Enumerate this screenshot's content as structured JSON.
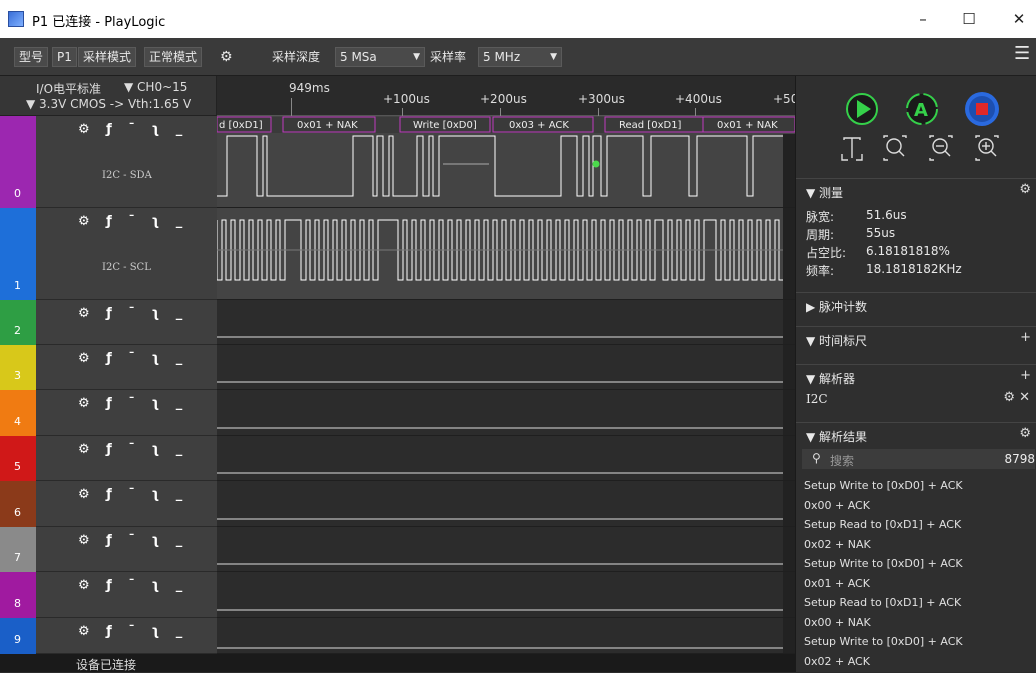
{
  "window": {
    "title": "P1 已连接 - PlayLogic",
    "controls": [
      "–",
      "☐",
      "✕"
    ]
  },
  "toolbar": {
    "model_label": "型号",
    "model_value": "P1",
    "mode_label": "采样模式",
    "mode_value": "正常模式",
    "depth_label": "采样深度",
    "depth_value": "5 MSa",
    "rate_label": "采样率",
    "rate_value": "5 MHz",
    "menu_icon": "hamburger-icon"
  },
  "channel_header": {
    "io_label": "I/O电平标准",
    "ch_range": "▼ CH0~15",
    "voltage": "▼ 3.3V CMOS -> Vth:1.65 V"
  },
  "ruler": {
    "cursor_time": "949ms",
    "ticks": [
      "+100us",
      "+200us",
      "+300us",
      "+400us",
      "+50"
    ]
  },
  "channels": [
    {
      "num": "0",
      "color": "#9c27b0",
      "label": "I2C - SDA"
    },
    {
      "num": "1",
      "color": "#1e6fd9",
      "label": "I2C - SCL"
    },
    {
      "num": "2",
      "color": "#2e9e44",
      "label": ""
    },
    {
      "num": "3",
      "color": "#d8c81a",
      "label": ""
    },
    {
      "num": "4",
      "color": "#f07b12",
      "label": ""
    },
    {
      "num": "5",
      "color": "#d01818",
      "label": ""
    },
    {
      "num": "6",
      "color": "#8b3a1a",
      "label": ""
    },
    {
      "num": "7",
      "color": "#8a8a8a",
      "label": ""
    },
    {
      "num": "8",
      "color": "#a01aa0",
      "label": ""
    },
    {
      "num": "9",
      "color": "#1a5fc8",
      "label": ""
    }
  ],
  "decode_labels": [
    "d [0xD1]",
    "0x01 + NAK",
    "Write [0xD0]",
    "0x03 + ACK",
    "Read [0xD1]",
    "0x01 + NAK"
  ],
  "status": "设备已连接",
  "panel": {
    "measure_title": "▼ 测量",
    "measure": [
      {
        "k": "脉宽:",
        "v": "51.6us"
      },
      {
        "k": "周期:",
        "v": "55us"
      },
      {
        "k": "占空比:",
        "v": "6.18181818%"
      },
      {
        "k": "频率:",
        "v": "18.1818182KHz"
      }
    ],
    "pulse_count": "▶ 脉冲计数",
    "time_marker": "▼ 时间标尺",
    "decoder": "▼ 解析器",
    "decoder_item": "I2C",
    "results_title": "▼ 解析结果",
    "search_placeholder": "搜索",
    "result_count": "8798",
    "results": [
      "Setup Write to [0xD0] + ACK",
      "0x00 + ACK",
      "Setup Read to [0xD1] + ACK",
      "0x02 + NAK",
      "Setup Write to [0xD0] + ACK",
      "0x01 + ACK",
      "Setup Read to [0xD1] + ACK",
      "0x00 + NAK",
      "Setup Write to [0xD0] + ACK",
      "0x02 + ACK"
    ]
  }
}
